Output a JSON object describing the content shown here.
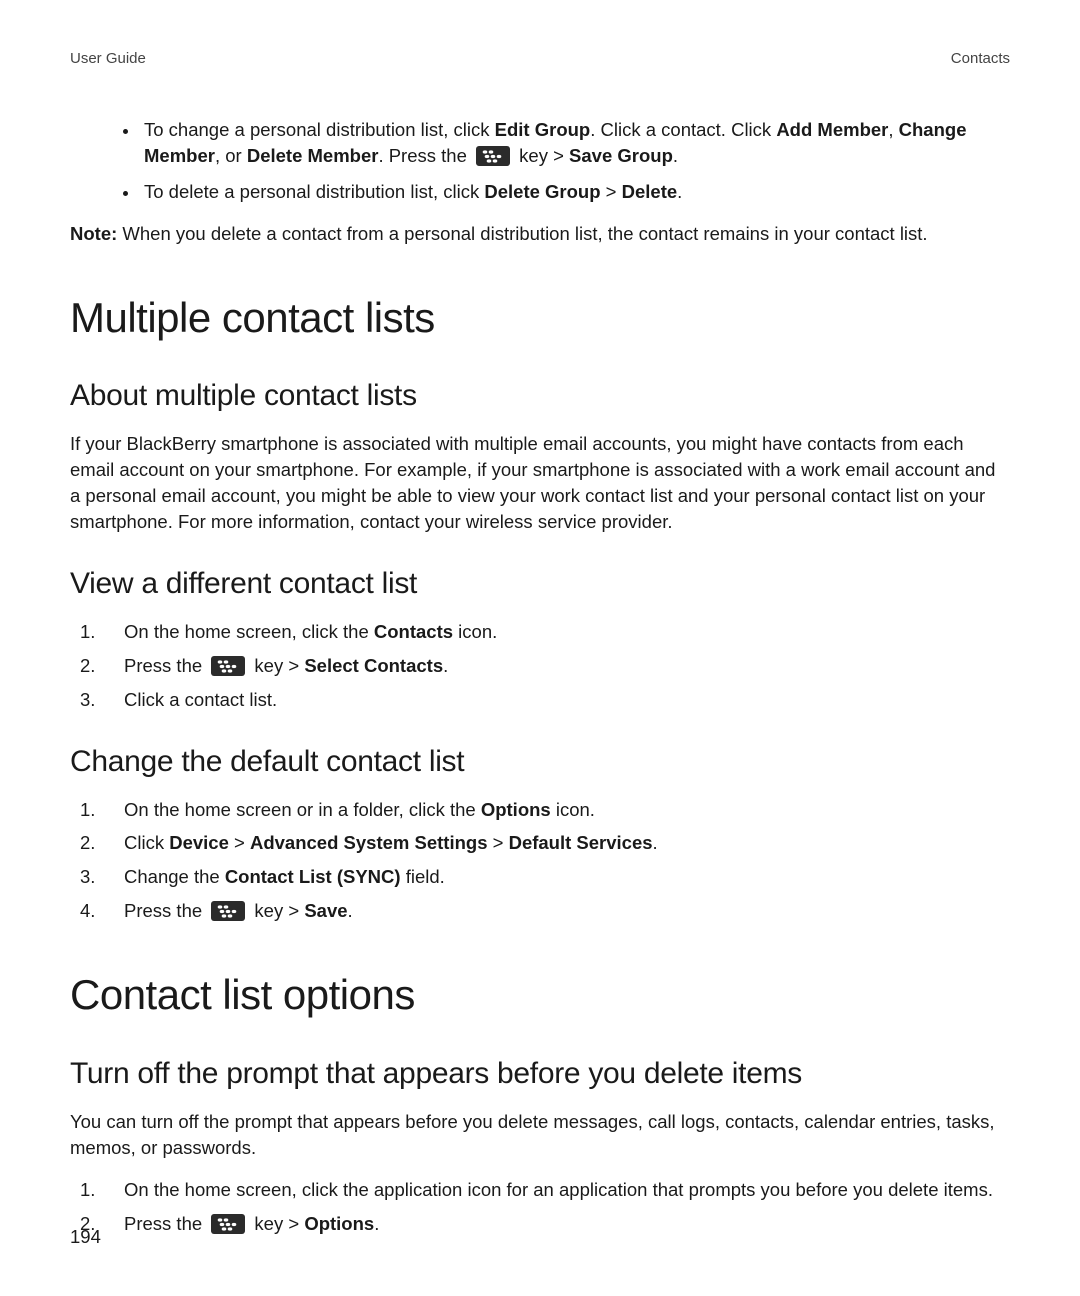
{
  "header": {
    "left": "User Guide",
    "right": "Contacts"
  },
  "intro": {
    "bullets": [
      {
        "pre1": "To change a personal distribution list, click ",
        "b1": "Edit Group",
        "mid1": ". Click a contact. Click ",
        "b2": "Add Member",
        "mid2": ", ",
        "b3": "Change Member",
        "mid3": ", or ",
        "b4": "Delete Member",
        "mid4": ". Press the ",
        "mid5": " key > ",
        "b5": "Save Group",
        "end": "."
      },
      {
        "pre1": "To delete a personal distribution list, click ",
        "b1": "Delete Group",
        "mid1": " > ",
        "b2": "Delete",
        "end": "."
      }
    ],
    "note_label": "Note:",
    "note_body": " When you delete a contact from a personal distribution list, the contact remains in your contact list."
  },
  "s_multiple": {
    "h1": "Multiple contact lists",
    "about_h2": "About multiple contact lists",
    "about_p": "If your BlackBerry smartphone is associated with multiple email accounts, you might have contacts from each email account on your smartphone. For example, if your smartphone is associated with a work email account and a personal email account, you might be able to view your work contact list and your personal contact list on your smartphone. For more information, contact your wireless service provider.",
    "view_h2": "View a different contact list",
    "view_steps": {
      "s1a": "On the home screen, click the ",
      "s1b": "Contacts",
      "s1c": " icon.",
      "s2a": "Press the ",
      "s2b": " key > ",
      "s2c": "Select Contacts",
      "s2d": ".",
      "s3": "Click a contact list."
    },
    "change_h2": "Change the default contact list",
    "change_steps": {
      "s1a": "On the home screen or in a folder, click the ",
      "s1b": "Options",
      "s1c": " icon.",
      "s2a": "Click ",
      "s2b": "Device",
      "s2c": " > ",
      "s2d": "Advanced System Settings",
      "s2e": " > ",
      "s2f": "Default Services",
      "s2g": ".",
      "s3a": "Change the ",
      "s3b": "Contact List (SYNC)",
      "s3c": " field.",
      "s4a": "Press the ",
      "s4b": " key > ",
      "s4c": "Save",
      "s4d": "."
    }
  },
  "s_options": {
    "h1": "Contact list options",
    "turnoff_h2": "Turn off the prompt that appears before you delete items",
    "turnoff_p": "You can turn off the prompt that appears before you delete messages, call logs, contacts, calendar entries, tasks, memos, or passwords.",
    "turnoff_steps": {
      "s1": "On the home screen, click the application icon for an application that prompts you before you delete items.",
      "s2a": "Press the ",
      "s2b": " key > ",
      "s2c": "Options",
      "s2d": "."
    }
  },
  "page_number": "194"
}
